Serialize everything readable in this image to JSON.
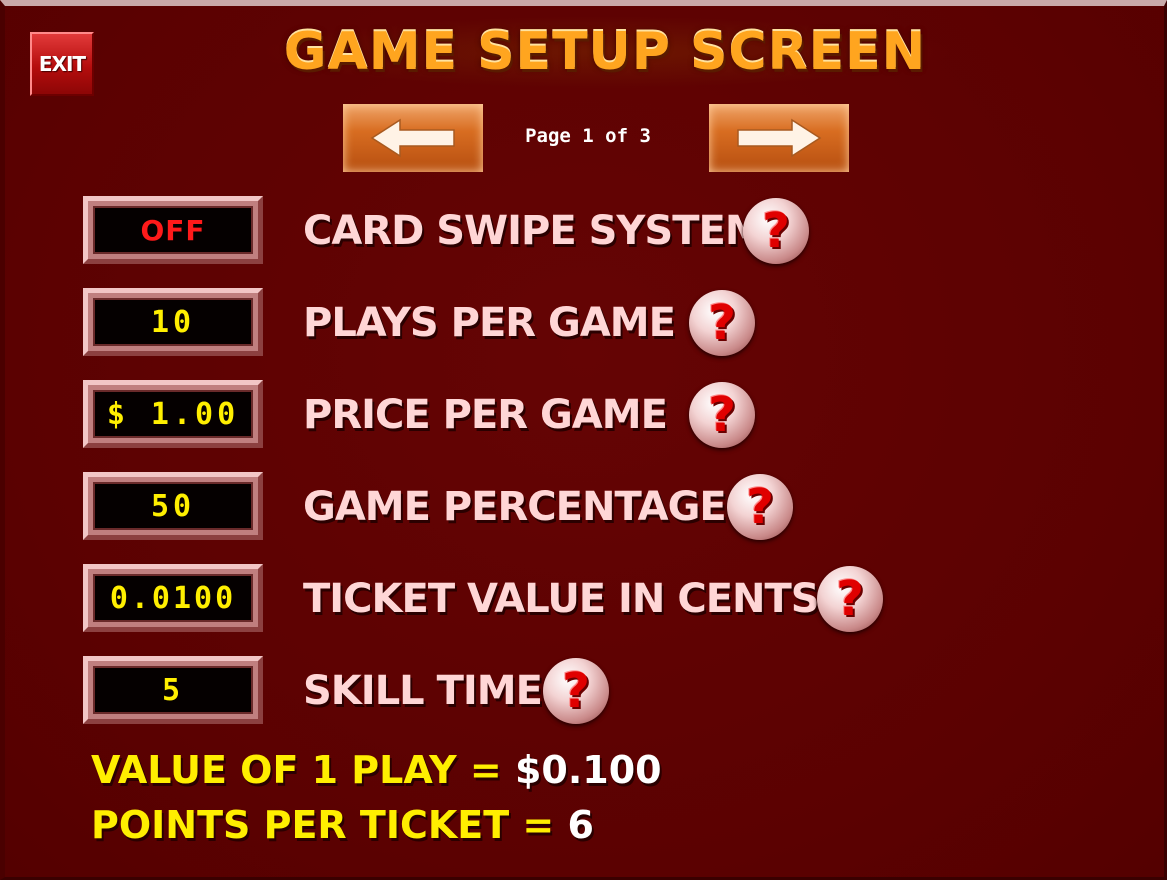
{
  "header": {
    "exit_label": "EXIT",
    "title": "GAME SETUP SCREEN",
    "page_label": "Page 1 of 3"
  },
  "settings": [
    {
      "value": "OFF",
      "label": "CARD SWIPE SYSTEM",
      "help": "?"
    },
    {
      "value": "10",
      "label": "PLAYS PER GAME",
      "help": "?"
    },
    {
      "value": "$ 1.00",
      "label": "PRICE PER GAME",
      "help": "?"
    },
    {
      "value": "50",
      "label": "GAME PERCENTAGE",
      "help": "?"
    },
    {
      "value": "0.0100",
      "label": "TICKET VALUE IN CENTS",
      "help": "?"
    },
    {
      "value": "5",
      "label": "SKILL TIME",
      "help": "?"
    }
  ],
  "summary": {
    "play_value_label": "VALUE OF 1 PLAY = ",
    "play_value": "$0.100",
    "points_label": "POINTS PER TICKET = ",
    "points": "6"
  },
  "colors": {
    "background": "#5e0202",
    "title": "#ffa51f",
    "value_text": "#ffef00",
    "off_text": "#ff1a1a",
    "label_text": "#ffd6d6",
    "summary_label": "#ffee00"
  },
  "icons": [
    "exit-button",
    "left-arrow-icon",
    "right-arrow-icon",
    "help-question-icon"
  ]
}
